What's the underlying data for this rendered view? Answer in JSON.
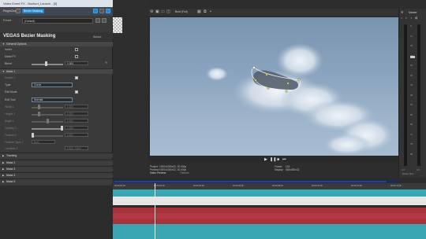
{
  "fx_window": {
    "title": "Video Event FX - Bozkurt_Launch - [0]",
    "chain_label": "Bezier Masking",
    "plugin_chain_label": "PluginChain",
    "preset_label": "Preset:",
    "preset_value": "(Default)",
    "plugin_title": "VEGAS Bezier Masking",
    "about_label": "About",
    "sections": {
      "general": "General Options",
      "invert": "Invert",
      "mask_fx": "Mask FX",
      "blend": "Blend",
      "blend_value": "1.000",
      "mask1": "Mask 1",
      "enable1": "Enable 1",
      "type": "Type",
      "type_value": "Curve",
      "edit_mode": "Edit Mode",
      "edit_tool": "Edit Tool",
      "edit_tool_value": "Normal",
      "width": "Width 1",
      "width_value": "0.200",
      "height": "Height 1",
      "height_value": "0.200",
      "angle": "Angle 1",
      "angle_value": "0.000",
      "opacity": "Opacity 1",
      "opacity_value": "1.000",
      "feather": "Feather 1",
      "feather_value": "0.000",
      "feather_type": "Feather Type 1",
      "feather_type_value": "Both",
      "location": "Location 1",
      "location_value": "0.500, 0.500",
      "tracking": "Tracking",
      "mask2": "Mask 2",
      "mask3": "Mask 3",
      "mask4": "Mask 4",
      "mask5": "Mask 5"
    }
  },
  "preview": {
    "quality": "Best (Full)",
    "project_label": "Project:",
    "project_value": "1920x1080x32, 30.000p",
    "preview_label": "Preview:",
    "preview_value": "1920x1080x32, 30.000p",
    "display_label": "Video Preview",
    "frame_label": "Frame:",
    "frame_value": "124",
    "display_size_label": "Display:",
    "display_size_value": "848x480x32",
    "trimmer_label": "Trimmer"
  },
  "master": {
    "title": "Master",
    "bus_label": "Master Bus",
    "level_left": "0.0",
    "level_right": "0.0",
    "ticks": [
      "6",
      "12",
      "18",
      "24",
      "30",
      "36",
      "42",
      "48",
      "54",
      "60",
      "66",
      "72",
      "78",
      "84"
    ]
  },
  "timeline": {
    "timecodes": [
      "00:00:00;00",
      "00:00:02;00",
      "00:00:04;00",
      "00:00:06;00",
      "00:00:08;00",
      "00:00:10;00",
      "00:00:12;00",
      "00:00:14;00"
    ]
  },
  "colors": {
    "accent": "#1f8ad0",
    "track_cyan": "#3aa6b4",
    "track_red": "#a8323c",
    "track_white": "#e6e6e6"
  }
}
